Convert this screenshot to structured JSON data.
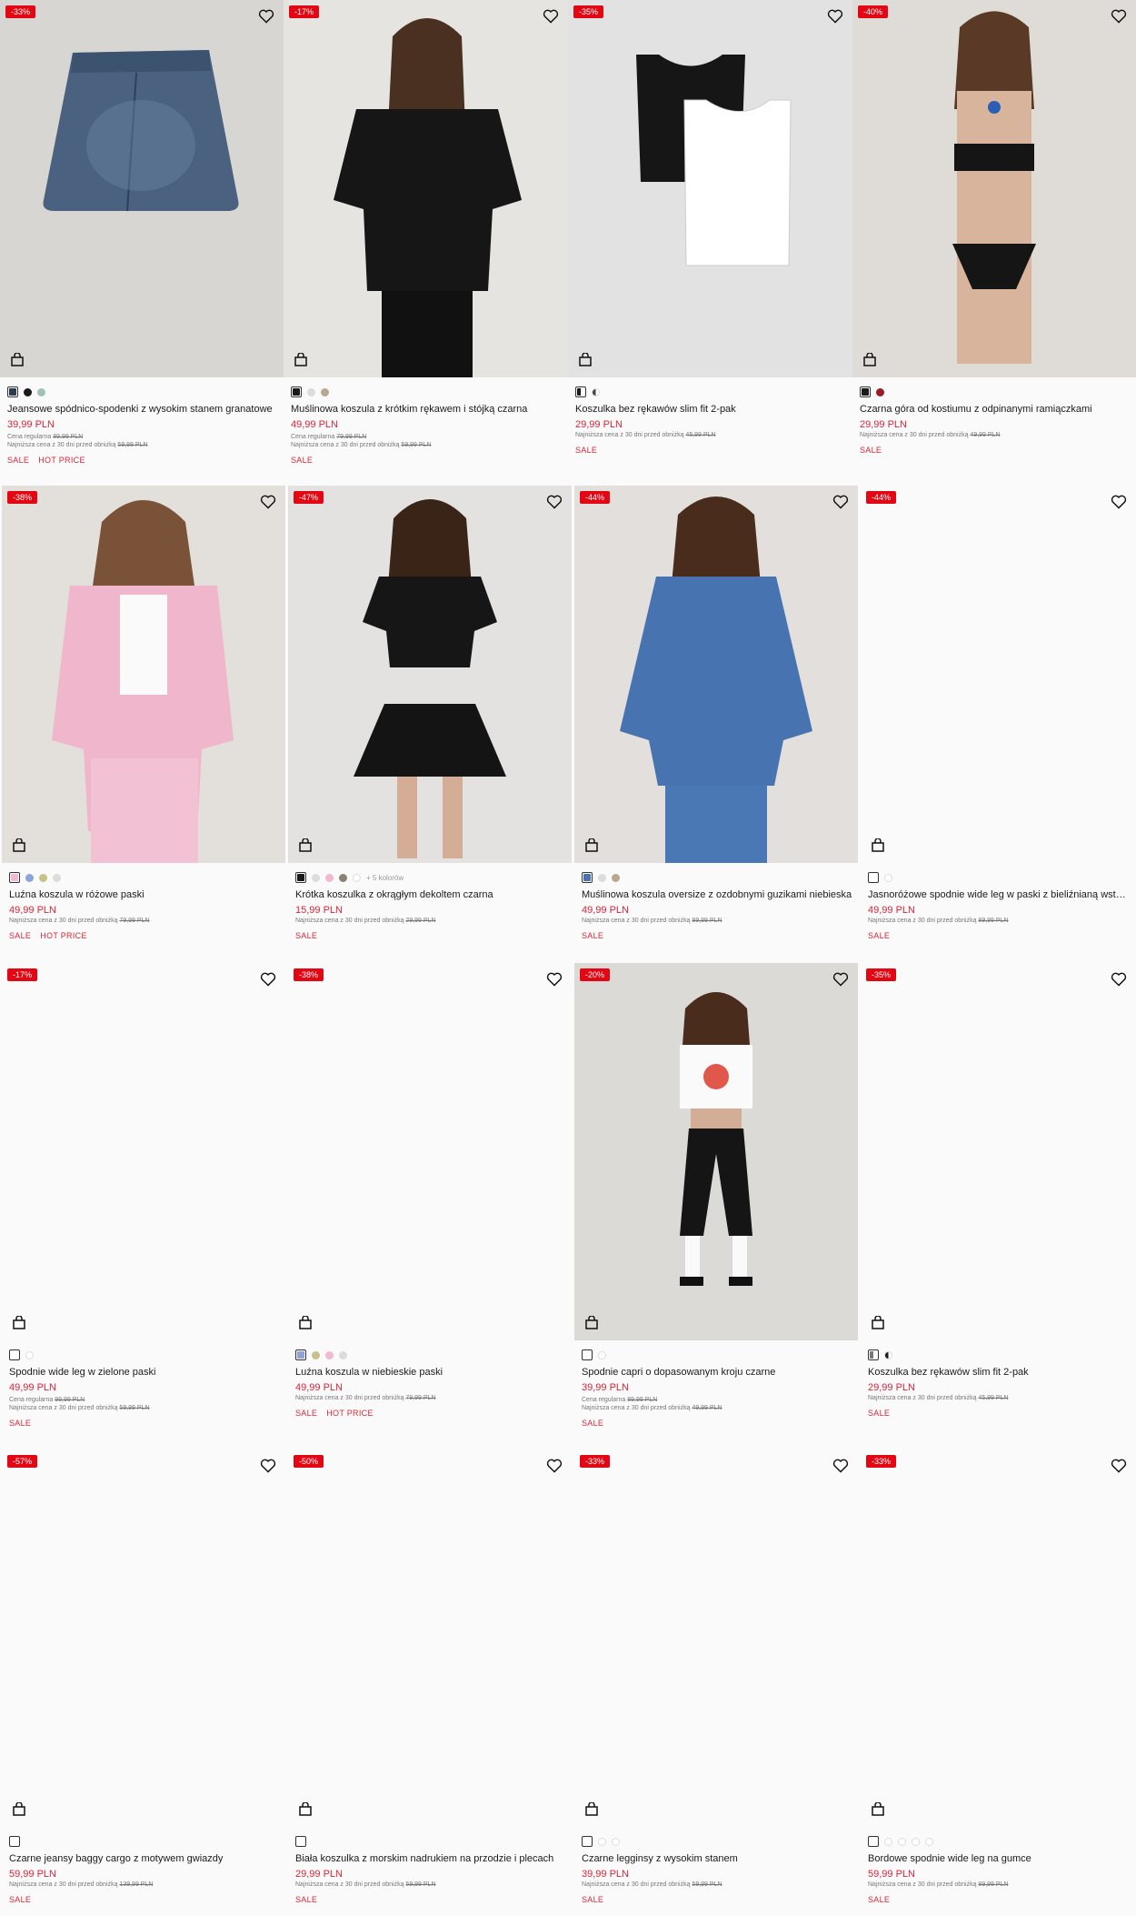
{
  "labels": {
    "regular_prefix": "Cena regularna",
    "lowest_prefix": "Najniższa cena z 30 dni przed obniżką"
  },
  "products": [
    {
      "badge": "-33%",
      "name": "Jeansowe spódnico-spodenki z wysokim stanem granatowe",
      "price": "39,99 PLN",
      "regular": "89,99 PLN",
      "lowest": "59,99 PLN",
      "tag1": "SALE",
      "tag2": "HOT PRICE",
      "colors": [
        "#2d3b55",
        "#1a1a1a",
        "#9ec2b8"
      ]
    },
    {
      "badge": "-17%",
      "name": "Muślinowa koszula z krótkim rękawem i stójką czarna",
      "price": "49,99 PLN",
      "regular": "79,99 PLN",
      "lowest": "59,99 PLN",
      "tag1": "SALE",
      "tag2": "",
      "colors": [
        "#1a1a1a",
        "#dcdcdc",
        "#b8a890"
      ]
    },
    {
      "badge": "-35%",
      "name": "Koszulka bez rękawów slim fit 2-pak",
      "price": "29,99 PLN",
      "regular": "",
      "lowest": "45,99 PLN",
      "tag1": "SALE",
      "tag2": "",
      "colors": [
        "#1a1a1a",
        "#444444"
      ]
    },
    {
      "badge": "-40%",
      "name": "Czarna góra od kostiumu z odpinanymi ramiączkami",
      "price": "29,99 PLN",
      "regular": "",
      "lowest": "49,99 PLN",
      "tag1": "SALE",
      "tag2": "",
      "colors": [
        "#1a1a1a",
        "#9b1b2a"
      ]
    },
    {
      "badge": "-38%",
      "name": "Luźna koszula w różowe paski",
      "price": "49,99 PLN",
      "regular": "",
      "lowest": "79,99 PLN",
      "tag1": "SALE",
      "tag2": "HOT PRICE",
      "colors": [
        "#f2b8cf",
        "#8fa4d6",
        "#c8c28a",
        "#dcdcdc"
      ]
    },
    {
      "badge": "-47%",
      "name": "Krótka koszulka z okrągłym dekoltem czarna",
      "price": "15,99 PLN",
      "regular": "",
      "lowest": "29,99 PLN",
      "tag1": "SALE",
      "tag2": "",
      "colors": [
        "#1a1a1a",
        "#dcdcdc",
        "#f2b8cf",
        "#8a8270",
        "#ffffff"
      ],
      "more": "+ 5 kolorów"
    },
    {
      "badge": "-44%",
      "name": "Muślinowa koszula oversize z ozdobnymi guzikami niebieska",
      "price": "49,99 PLN",
      "regular": "",
      "lowest": "89,99 PLN",
      "tag1": "SALE",
      "tag2": "",
      "colors": [
        "#4a73b0",
        "#dcdcdc",
        "#b8a890"
      ]
    },
    {
      "badge": "-44%",
      "name": "Jasnoróżowe spodnie wide leg w paski z bieliźnianą wstawką",
      "price": "49,99 PLN",
      "regular": "",
      "lowest": "89,99 PLN",
      "tag1": "SALE",
      "tag2": "",
      "colors": [
        "#ffffff",
        "#ffffff"
      ]
    },
    {
      "badge": "-17%",
      "name": "Spodnie wide leg w zielone paski",
      "price": "49,99 PLN",
      "regular": "99,99 PLN",
      "lowest": "59,99 PLN",
      "tag1": "SALE",
      "tag2": "",
      "colors": [
        "#ffffff",
        "#ffffff"
      ]
    },
    {
      "badge": "-38%",
      "name": "Luźna koszula w niebieskie paski",
      "price": "49,99 PLN",
      "regular": "",
      "lowest": "79,99 PLN",
      "tag1": "SALE",
      "tag2": "HOT PRICE",
      "colors": [
        "#8fa4d6",
        "#c8c28a",
        "#f2b8cf",
        "#dcdcdc"
      ]
    },
    {
      "badge": "-20%",
      "name": "Spodnie capri o dopasowanym kroju czarne",
      "price": "39,99 PLN",
      "regular": "89,99 PLN",
      "lowest": "49,99 PLN",
      "tag1": "SALE",
      "tag2": "",
      "colors": [
        "#ffffff",
        "#ffffff"
      ]
    },
    {
      "badge": "-35%",
      "name": "Koszulka bez rękawów slim fit 2-pak",
      "price": "29,99 PLN",
      "regular": "",
      "lowest": "45,99 PLN",
      "tag1": "SALE",
      "tag2": "",
      "colors": [
        "#777777",
        "#1a1a1a"
      ]
    },
    {
      "badge": "-57%",
      "name": "Czarne jeansy baggy cargo z motywem gwiazdy",
      "price": "59,99 PLN",
      "regular": "",
      "lowest": "139,99 PLN",
      "tag1": "SALE",
      "tag2": "",
      "colors": [
        "#ffffff"
      ]
    },
    {
      "badge": "-50%",
      "name": "Biała koszulka z morskim nadrukiem na przodzie i plecach",
      "price": "29,99 PLN",
      "regular": "",
      "lowest": "59,99 PLN",
      "tag1": "SALE",
      "tag2": "",
      "colors": [
        "#ffffff"
      ]
    },
    {
      "badge": "-33%",
      "name": "Czarne legginsy z wysokim stanem",
      "price": "39,99 PLN",
      "regular": "",
      "lowest": "59,99 PLN",
      "tag1": "SALE",
      "tag2": "",
      "colors": [
        "#ffffff",
        "#ffffff",
        "#ffffff"
      ]
    },
    {
      "badge": "-33%",
      "name": "Bordowe spodnie wide leg na gumce",
      "price": "59,99 PLN",
      "regular": "",
      "lowest": "89,99 PLN",
      "tag1": "SALE",
      "tag2": "",
      "colors": [
        "#ffffff",
        "#ffffff",
        "#ffffff",
        "#ffffff",
        "#ffffff"
      ]
    }
  ]
}
